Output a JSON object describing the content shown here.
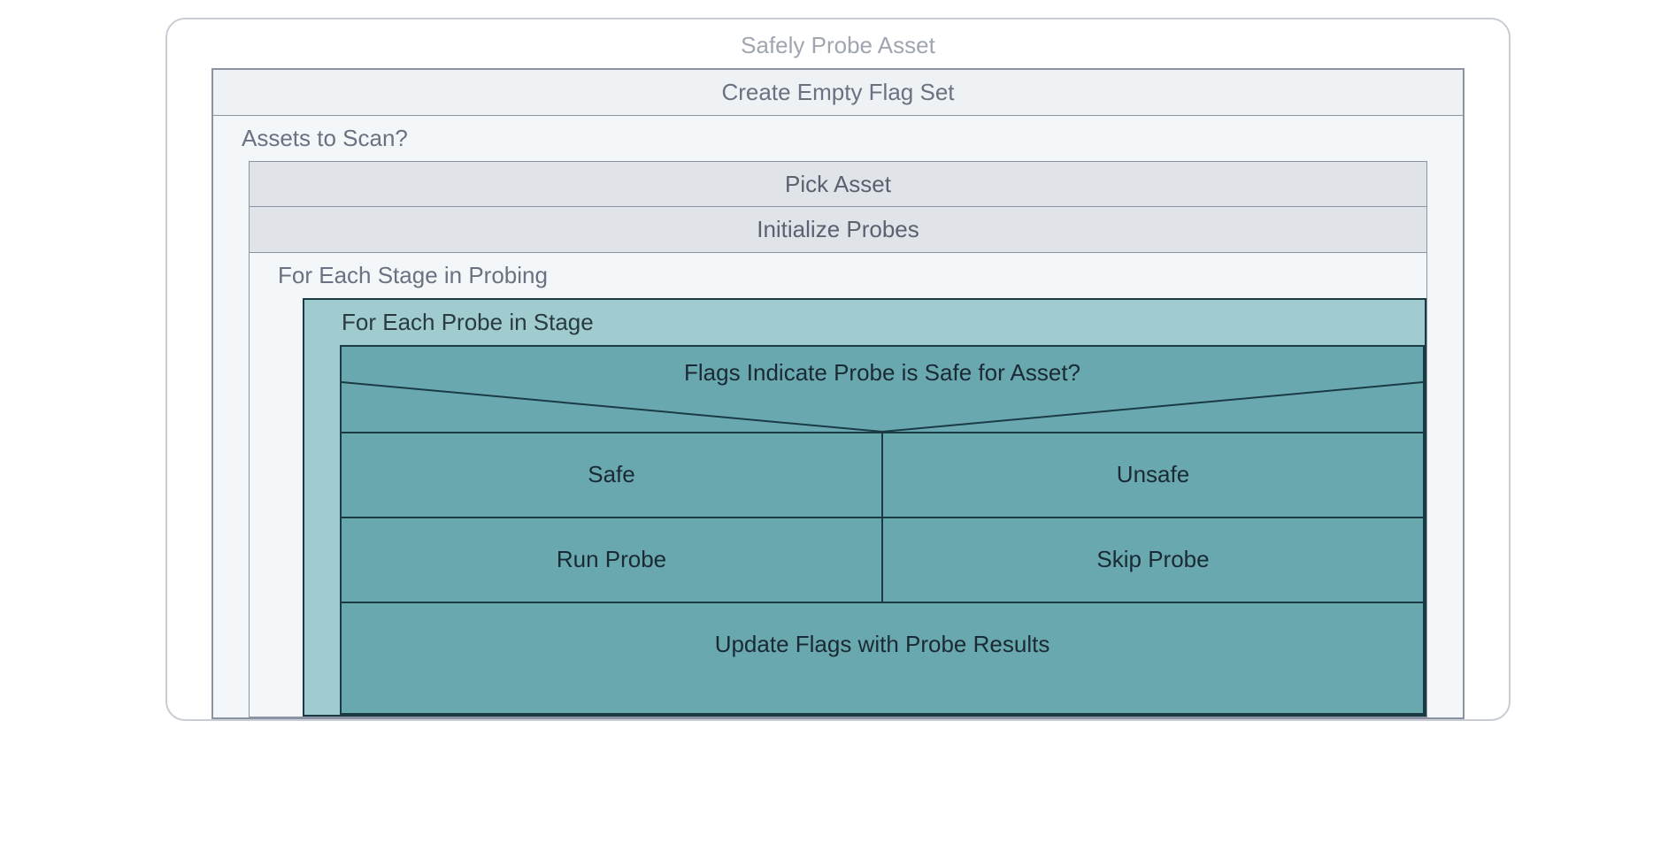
{
  "diagram": {
    "title": "Safely Probe Asset",
    "create_flag_set": "Create Empty Flag Set",
    "assets_to_scan": "Assets to Scan?",
    "pick_asset": "Pick Asset",
    "initialize_probes": "Initialize Probes",
    "for_each_stage": "For Each Stage in Probing",
    "for_each_probe": "For Each Probe in Stage",
    "decision_question": "Flags Indicate Probe is Safe for Asset?",
    "branches": {
      "safe": "Safe",
      "unsafe": "Unsafe",
      "run_probe": "Run Probe",
      "skip_probe": "Skip Probe"
    },
    "update_flags": "Update Flags with Probe Results"
  },
  "chart_data": {
    "type": "nassi-shneiderman-diagram",
    "title": "Safely Probe Asset",
    "structure": {
      "block": "sequence",
      "children": [
        {
          "block": "process",
          "label": "Create Empty Flag Set"
        },
        {
          "block": "while",
          "condition": "Assets to Scan?",
          "body": [
            {
              "block": "process",
              "label": "Pick Asset"
            },
            {
              "block": "process",
              "label": "Initialize Probes"
            },
            {
              "block": "for",
              "condition": "For Each Stage in Probing",
              "body": [
                {
                  "block": "for",
                  "condition": "For Each Probe in Stage",
                  "body": [
                    {
                      "block": "decision",
                      "condition": "Flags Indicate Probe is Safe for Asset?",
                      "branches": [
                        {
                          "label": "Safe",
                          "body": [
                            {
                              "block": "process",
                              "label": "Run Probe"
                            }
                          ]
                        },
                        {
                          "label": "Unsafe",
                          "body": [
                            {
                              "block": "process",
                              "label": "Skip Probe"
                            }
                          ]
                        }
                      ]
                    },
                    {
                      "block": "process",
                      "label": "Update Flags with Probe Results"
                    }
                  ]
                }
              ]
            }
          ]
        }
      ]
    }
  }
}
